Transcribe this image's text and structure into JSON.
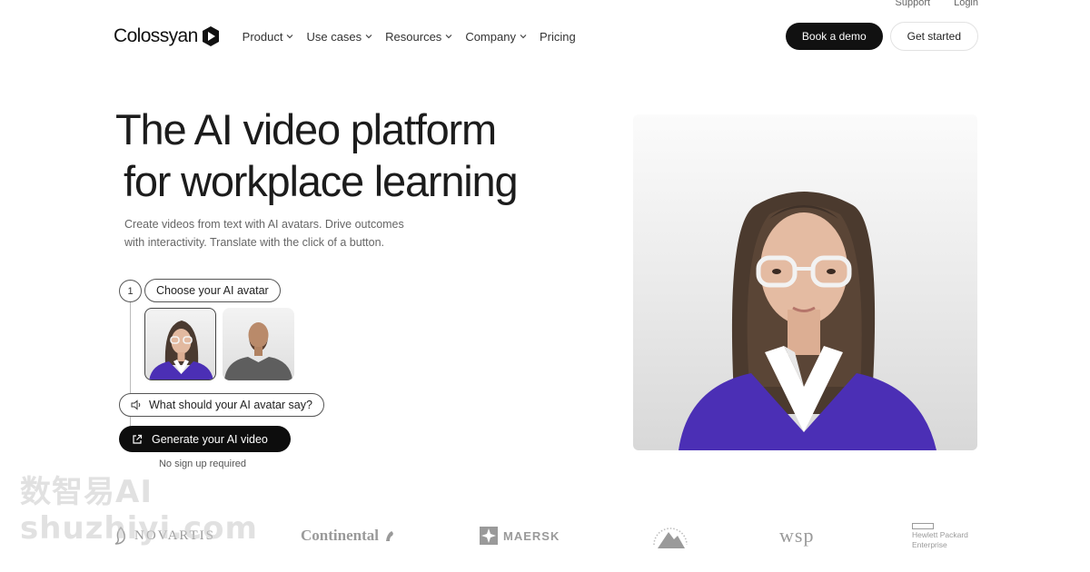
{
  "topbar": {
    "support": "Support",
    "login": "Login"
  },
  "brand": {
    "name": "Colossyan"
  },
  "nav": {
    "items": [
      {
        "label": "Product",
        "dropdown": true
      },
      {
        "label": "Use cases",
        "dropdown": true
      },
      {
        "label": "Resources",
        "dropdown": true
      },
      {
        "label": "Company",
        "dropdown": true
      },
      {
        "label": "Pricing",
        "dropdown": false
      }
    ],
    "book_demo": "Book a demo",
    "get_started": "Get started"
  },
  "hero": {
    "headline_line1": "The AI video platform",
    "headline_line2": "for workplace learning",
    "subtitle": "Create videos from text with AI avatars. Drive outcomes with interactivity. Translate with the click of a button.",
    "step_number": "1",
    "choose_avatar": "Choose your AI avatar",
    "say_placeholder": "What should your AI avatar say?",
    "generate": "Generate your AI video",
    "no_signup": "No sign up required"
  },
  "logos": {
    "novartis": "NOVARTIS",
    "continental": "Continental",
    "maersk": "MAERSK",
    "wsp": "wsp",
    "hpe_line1": "Hewlett Packard",
    "hpe_line2": "Enterprise"
  },
  "watermark": {
    "line1": "数智易AI",
    "line2": "shuzhiyi.com"
  },
  "colors": {
    "primary_dark": "#0d0d0d",
    "sweater": "#4b2fb5",
    "logo_gray": "#9a9a9a"
  }
}
